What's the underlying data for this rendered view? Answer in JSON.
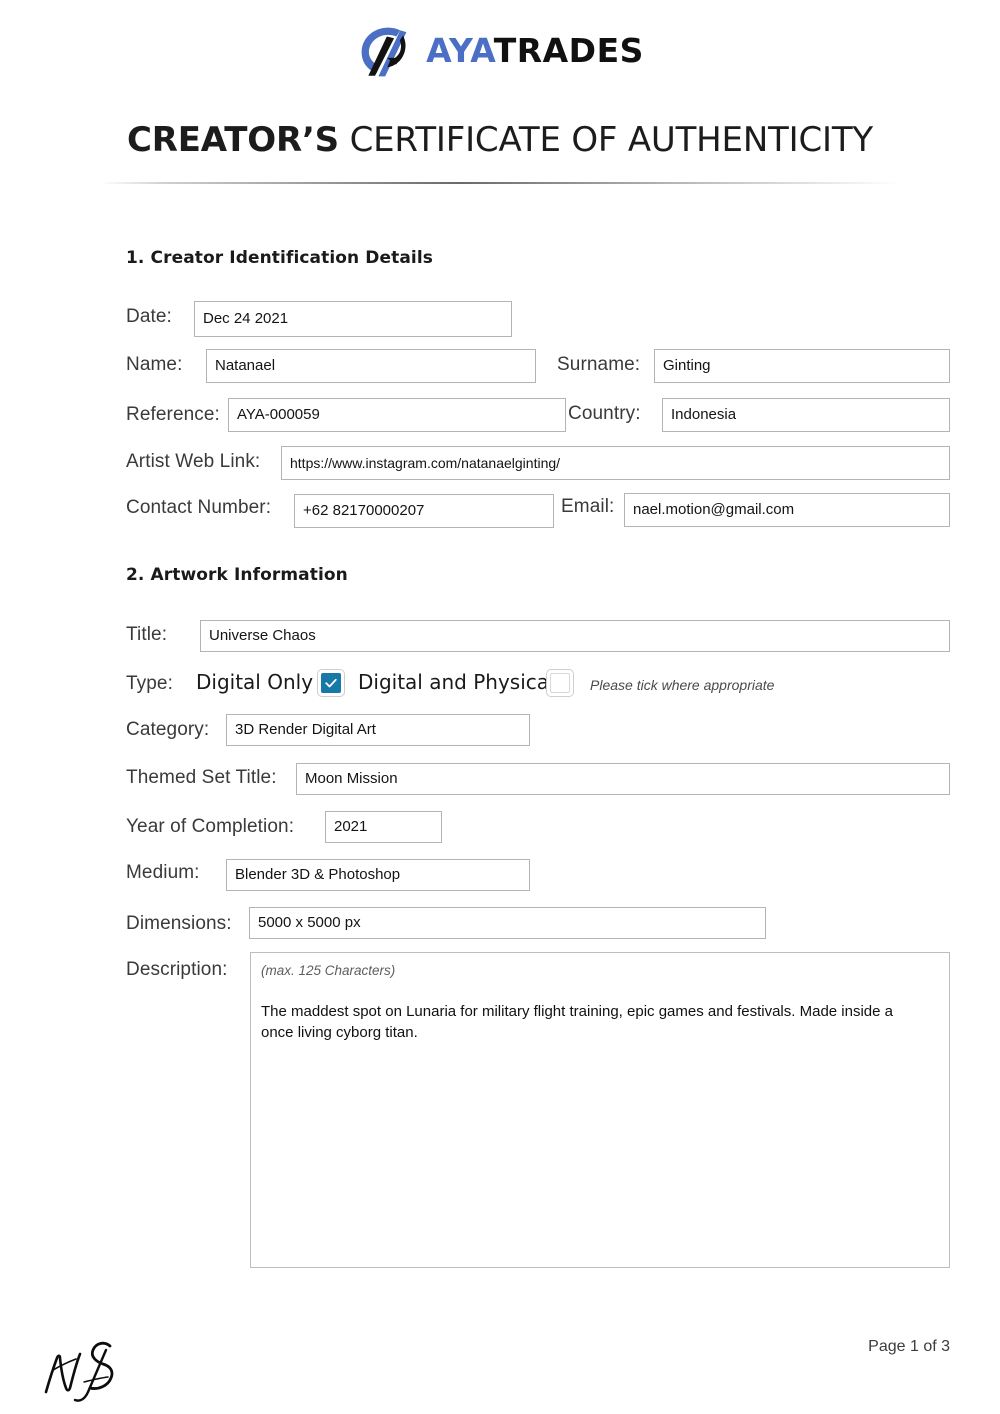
{
  "brand": {
    "logo_icon": "ayatrades-arrow-logo-icon",
    "name_part1": "AYA",
    "name_part2": "TRADES",
    "accent_color": "#4a6fc4",
    "dark_color": "#111111"
  },
  "document": {
    "title_strong": "CREATOR’S",
    "title_light": "CERTIFICATE OF AUTHENTICITY"
  },
  "sections": {
    "creator_identification": {
      "heading": "1. Creator Identification Details",
      "fields": {
        "date": {
          "label": "Date:",
          "value": "Dec 24 2021"
        },
        "name": {
          "label": "Name:",
          "value": "Natanael"
        },
        "surname": {
          "label": "Surname:",
          "value": "Ginting"
        },
        "reference": {
          "label": "Reference:",
          "value": "AYA-000059"
        },
        "country": {
          "label": "Country:",
          "value": "Indonesia"
        },
        "artist_web_link": {
          "label": "Artist Web Link:",
          "value": "https://www.instagram.com/natanaelginting/"
        },
        "contact_number": {
          "label": "Contact Number:",
          "value": "+62 82170000207"
        },
        "email": {
          "label": "Email:",
          "value": "nael.motion@gmail.com"
        }
      }
    },
    "artwork_information": {
      "heading": "2. Artwork Information",
      "fields": {
        "title": {
          "label": "Title:",
          "value": "Universe Chaos"
        },
        "type": {
          "label": "Type:",
          "option_digital_only": "Digital Only",
          "option_digital_and_physical": "Digital and Physical",
          "digital_only_checked": true,
          "digital_and_physical_checked": false,
          "checkbox_color": "#1878a8",
          "hint": "Please tick where appropriate"
        },
        "category": {
          "label": "Category:",
          "value": "3D Render Digital Art"
        },
        "themed_set_title": {
          "label": "Themed Set Title:",
          "value": "Moon Mission"
        },
        "year_of_completion": {
          "label": "Year of Completion:",
          "value": "2021"
        },
        "medium": {
          "label": "Medium:",
          "value": "Blender 3D & Photoshop"
        },
        "dimensions": {
          "label": "Dimensions:",
          "value": "5000 x 5000 px"
        },
        "description": {
          "label": "Description:",
          "hint": "(max. 125 Characters)",
          "value": "The maddest spot on Lunaria for military flight training, epic games and festivals. Made inside a once living cyborg titan."
        }
      }
    }
  },
  "footer": {
    "page_indicator": "Page 1 of 3",
    "signature_icon": "handwritten-signature-ng"
  }
}
